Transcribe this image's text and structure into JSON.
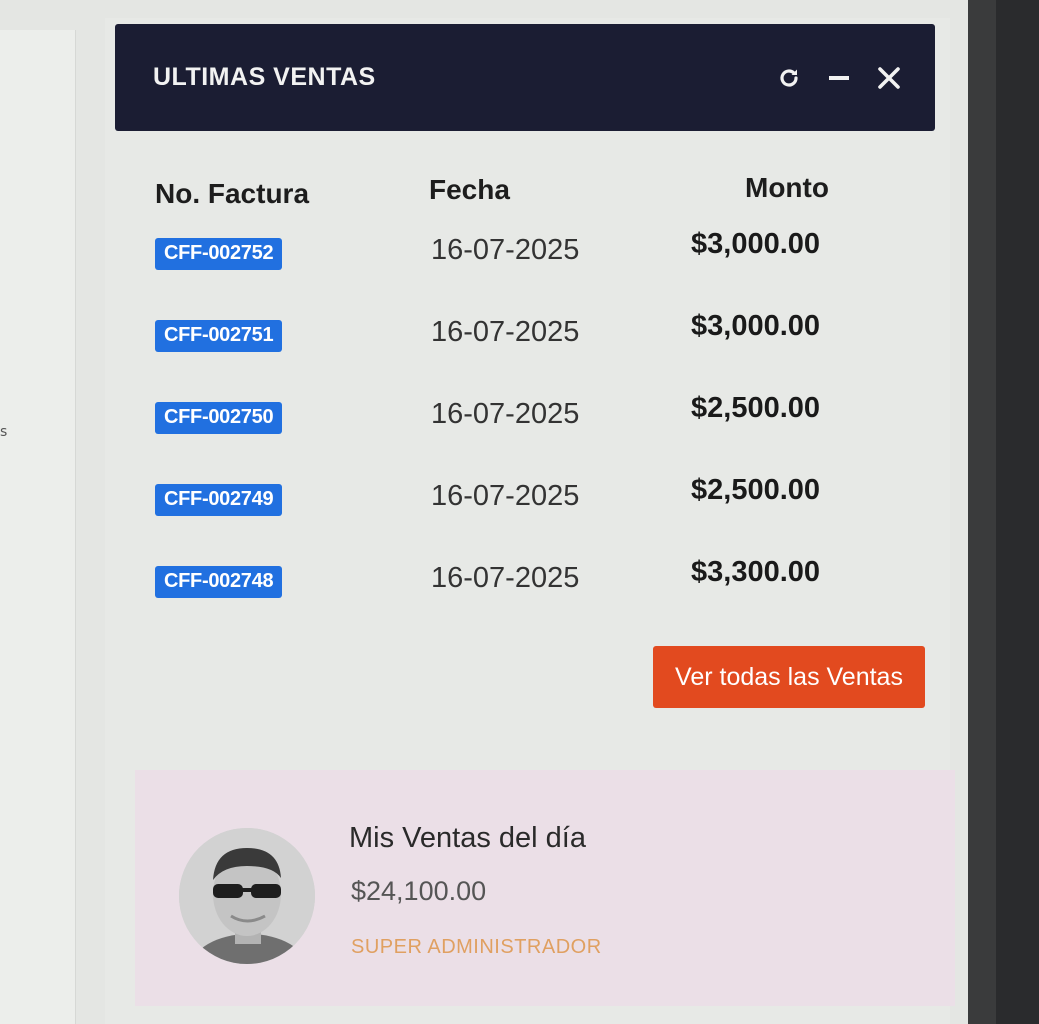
{
  "widget": {
    "title": "ULTIMAS VENTAS",
    "tools": [
      {
        "icon": "refresh-icon"
      },
      {
        "icon": "minimize-icon"
      },
      {
        "icon": "close-icon"
      }
    ]
  },
  "table": {
    "headers": [
      "No. Factura",
      "Fecha",
      "Monto"
    ],
    "rows": [
      {
        "factura": "CFF-002752",
        "fecha": "16-07-2025",
        "monto": "$3,000.00"
      },
      {
        "factura": "CFF-002751",
        "fecha": "16-07-2025",
        "monto": "$3,000.00"
      },
      {
        "factura": "CFF-002750",
        "fecha": "16-07-2025",
        "monto": "$2,500.00"
      },
      {
        "factura": "CFF-002749",
        "fecha": "16-07-2025",
        "monto": "$2,500.00"
      },
      {
        "factura": "CFF-002748",
        "fecha": "16-07-2025",
        "monto": "$3,300.00"
      }
    ]
  },
  "actions": {
    "view_all_label": "Ver todas las Ventas"
  },
  "user_card": {
    "title": "Mis Ventas del día",
    "amount": "$24,100.00",
    "role": "SUPER ADMINISTRADOR"
  },
  "left_panel": {
    "glyph": "s"
  },
  "colors": {
    "header_bg": "#1b1d33",
    "badge_bg": "#2170e0",
    "button_bg": "#e24a1f",
    "card_bg": "#ebdfe7",
    "role_text": "#e0a061"
  }
}
